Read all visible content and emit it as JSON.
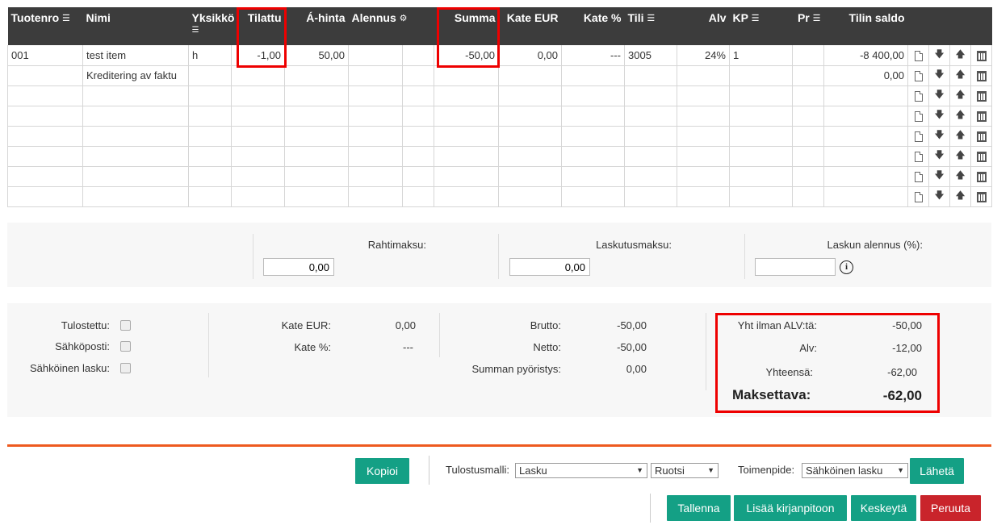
{
  "columns": [
    {
      "label": "Tuotenro",
      "icon": "list-icon"
    },
    {
      "label": "Nimi"
    },
    {
      "label": "Yksikkö",
      "icon": "list-icon"
    },
    {
      "label": "Tilattu"
    },
    {
      "label": "Á-hinta"
    },
    {
      "label": "Alennus",
      "icon": "settings-icon"
    },
    {
      "label": ""
    },
    {
      "label": "Summa"
    },
    {
      "label": "Kate EUR"
    },
    {
      "label": "Kate %"
    },
    {
      "label": "Tili",
      "icon": "list-icon"
    },
    {
      "label": "Alv"
    },
    {
      "label": "KP",
      "icon": "list-icon"
    },
    {
      "label": "Pr",
      "icon": "list-icon"
    },
    {
      "label": "Tilin saldo"
    }
  ],
  "rows": [
    {
      "tuotenro": "001",
      "nimi": "test item",
      "yksikko": "h",
      "tilattu": "-1,00",
      "ahinta": "50,00",
      "alennus": "",
      "extra": "",
      "summa": "-50,00",
      "kate_eur": "0,00",
      "kate_pct": "---",
      "tili": "3005",
      "alv": "24%",
      "kp": "1",
      "pr": "",
      "saldo": "-8 400,00"
    },
    {
      "tuotenro": "",
      "nimi": "Kreditering av faktu",
      "yksikko": "",
      "tilattu": "",
      "ahinta": "",
      "alennus": "",
      "extra": "",
      "summa": "",
      "kate_eur": "",
      "kate_pct": "",
      "tili": "",
      "alv": "",
      "kp": "",
      "pr": "",
      "saldo": "0,00"
    },
    {
      "tuotenro": "",
      "nimi": "",
      "yksikko": "",
      "tilattu": "",
      "ahinta": "",
      "alennus": "",
      "extra": "",
      "summa": "",
      "kate_eur": "",
      "kate_pct": "",
      "tili": "",
      "alv": "",
      "kp": "",
      "pr": "",
      "saldo": ""
    },
    {
      "tuotenro": "",
      "nimi": "",
      "yksikko": "",
      "tilattu": "",
      "ahinta": "",
      "alennus": "",
      "extra": "",
      "summa": "",
      "kate_eur": "",
      "kate_pct": "",
      "tili": "",
      "alv": "",
      "kp": "",
      "pr": "",
      "saldo": ""
    },
    {
      "tuotenro": "",
      "nimi": "",
      "yksikko": "",
      "tilattu": "",
      "ahinta": "",
      "alennus": "",
      "extra": "",
      "summa": "",
      "kate_eur": "",
      "kate_pct": "",
      "tili": "",
      "alv": "",
      "kp": "",
      "pr": "",
      "saldo": ""
    },
    {
      "tuotenro": "",
      "nimi": "",
      "yksikko": "",
      "tilattu": "",
      "ahinta": "",
      "alennus": "",
      "extra": "",
      "summa": "",
      "kate_eur": "",
      "kate_pct": "",
      "tili": "",
      "alv": "",
      "kp": "",
      "pr": "",
      "saldo": ""
    },
    {
      "tuotenro": "",
      "nimi": "",
      "yksikko": "",
      "tilattu": "",
      "ahinta": "",
      "alennus": "",
      "extra": "",
      "summa": "",
      "kate_eur": "",
      "kate_pct": "",
      "tili": "",
      "alv": "",
      "kp": "",
      "pr": "",
      "saldo": ""
    },
    {
      "tuotenro": "",
      "nimi": "",
      "yksikko": "",
      "tilattu": "",
      "ahinta": "",
      "alennus": "",
      "extra": "",
      "summa": "",
      "kate_eur": "",
      "kate_pct": "",
      "tili": "",
      "alv": "",
      "kp": "",
      "pr": "",
      "saldo": ""
    }
  ],
  "row_actions": [
    "document-icon",
    "arrow-down-icon",
    "arrow-up-icon",
    "trash-icon"
  ],
  "fees": {
    "rahtimaksu_label": "Rahtimaksu:",
    "rahtimaksu_value": "0,00",
    "laskutusmaksu_label": "Laskutusmaksu:",
    "laskutusmaksu_value": "0,00",
    "alennus_label": "Laskun alennus (%):",
    "alennus_value": ""
  },
  "flags": {
    "tulostettu": "Tulostettu:",
    "sahkoposti": "Sähköposti:",
    "sahkoinen_lasku": "Sähköinen lasku:"
  },
  "margin": {
    "kate_eur_label": "Kate EUR:",
    "kate_eur_value": "0,00",
    "kate_pct_label": "Kate %:",
    "kate_pct_value": "---"
  },
  "amounts": {
    "brutto_label": "Brutto:",
    "brutto_value": "-50,00",
    "netto_label": "Netto:",
    "netto_value": "-50,00",
    "rounding_label": "Summan pyöristys:",
    "rounding_value": "0,00"
  },
  "summary": {
    "excl_vat_label": "Yht ilman ALV:tä:",
    "excl_vat_value": "-50,00",
    "vat_label": "Alv:",
    "vat_value": "-12,00",
    "total_label": "Yhteensä:",
    "total_value": "-62,00",
    "payable_label": "Maksettava:",
    "payable_value": "-62,00"
  },
  "actions": {
    "kopioi": "Kopioi",
    "template_label": "Tulostusmalli:",
    "template_value": "Lasku",
    "language_value": "Ruotsi",
    "operation_label": "Toimenpide:",
    "operation_value": "Sähköinen lasku",
    "send": "Lähetä",
    "save": "Tallenna",
    "post": "Lisää kirjanpitoon",
    "suspend": "Keskeytä",
    "cancel": "Peruuta"
  },
  "colors": {
    "header_bg": "#3c3c3c",
    "accent_green": "#14a085",
    "cancel_red": "#c9242b",
    "highlight_red": "#e00000",
    "divider_orange": "#ee5a1f"
  }
}
